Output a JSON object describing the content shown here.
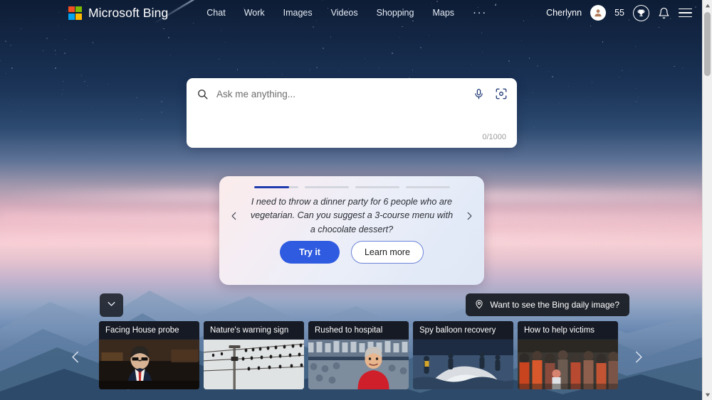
{
  "header": {
    "logo_icon": "microsoft-squares-icon",
    "brand_name": "Microsoft Bing",
    "nav_items": [
      {
        "label": "Chat"
      },
      {
        "label": "Work"
      },
      {
        "label": "Images"
      },
      {
        "label": "Videos"
      },
      {
        "label": "Shopping"
      },
      {
        "label": "Maps"
      }
    ],
    "more_label": "···",
    "user_name": "Cherlynn",
    "avatar_icon": "user-avatar-icon",
    "rewards_points": "55",
    "rewards_icon": "trophy-icon",
    "notifications_icon": "bell-icon",
    "menu_icon": "hamburger-menu-icon"
  },
  "search": {
    "search_icon": "search-icon",
    "placeholder": "Ask me anything...",
    "value": "",
    "mic_icon": "microphone-icon",
    "camera_icon": "visual-search-camera-icon",
    "char_counter": "0/1000"
  },
  "suggestion": {
    "progress_bars": [
      80,
      0,
      0,
      0
    ],
    "prev_icon": "chevron-left-icon",
    "next_icon": "chevron-right-icon",
    "prompt": "I need to throw a dinner party for 6 people who are vegetarian. Can you suggest a 3-course menu with a chocolate dessert?",
    "try_label": "Try it",
    "learn_label": "Learn more"
  },
  "daily_image": {
    "pin_icon": "location-pin-icon",
    "label": "Want to see the Bing daily image?"
  },
  "collapse": {
    "icon": "chevron-down-icon"
  },
  "news": {
    "prev_icon": "chevron-left-icon",
    "next_icon": "chevron-right-icon",
    "cards": [
      {
        "title": "Facing House probe"
      },
      {
        "title": "Nature's warning sign"
      },
      {
        "title": "Rushed to hospital"
      },
      {
        "title": "Spy balloon recovery"
      },
      {
        "title": "How to help victims"
      }
    ]
  },
  "scrollbar": {
    "up_icon": "scroll-up-arrow-icon",
    "down_icon": "scroll-down-arrow-icon"
  },
  "colors": {
    "accent_blue": "#2f5be0",
    "progress_fill": "#1f3bad",
    "logo_red": "#f25022",
    "logo_green": "#7fba00",
    "logo_blue": "#00a4ef",
    "logo_yellow": "#ffb900"
  }
}
